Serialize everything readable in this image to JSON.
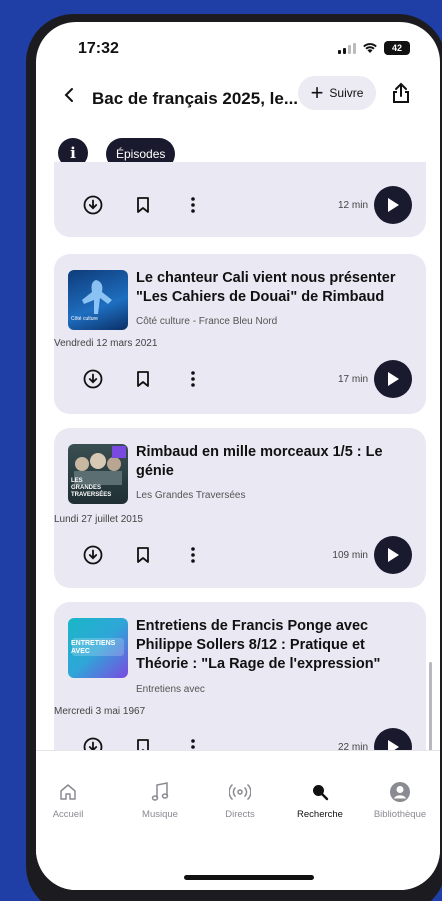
{
  "status": {
    "time": "17:32",
    "battery": "42"
  },
  "header": {
    "title": "Bac de français 2025, le...",
    "follow_label": "Suivre"
  },
  "tabs": {
    "episodes_label": "Épisodes"
  },
  "episodes": [
    {
      "title": "",
      "show": "",
      "date": "",
      "duration": "12 min"
    },
    {
      "title": "Le chanteur Cali vient nous présenter \"Les Cahiers de Douai\" de Rimbaud",
      "show": "Côté culture - France Bleu Nord",
      "date": "Vendredi 12 mars 2021",
      "duration": "17 min",
      "thumb_text": "Côté culture"
    },
    {
      "title": "Rimbaud en mille morceaux 1/5 : Le génie",
      "show": "Les Grandes Traversées",
      "date": "Lundi 27 juillet 2015",
      "duration": "109 min",
      "thumb_text": "LES GRANDES TRAVERSÉES"
    },
    {
      "title": "Entretiens de Francis Ponge avec Philippe Sollers 8/12 : Pratique et Théorie : \"La Rage de l'expression\"",
      "show": "Entretiens avec",
      "date": "Mercredi 3 mai 1967",
      "duration": "22 min",
      "thumb_text": "ENTRETIENS AVEC"
    }
  ],
  "tabbar": [
    {
      "label": "Accueil",
      "icon": "home-icon"
    },
    {
      "label": "Musique",
      "icon": "music-note-icon"
    },
    {
      "label": "Directs",
      "icon": "broadcast-icon"
    },
    {
      "label": "Recherche",
      "icon": "search-icon",
      "active": true
    },
    {
      "label": "Bibliothèque",
      "icon": "profile-icon"
    }
  ],
  "colors": {
    "background": "#1f3fa6",
    "card": "#e9e8f3",
    "dark": "#1a1a2e"
  }
}
